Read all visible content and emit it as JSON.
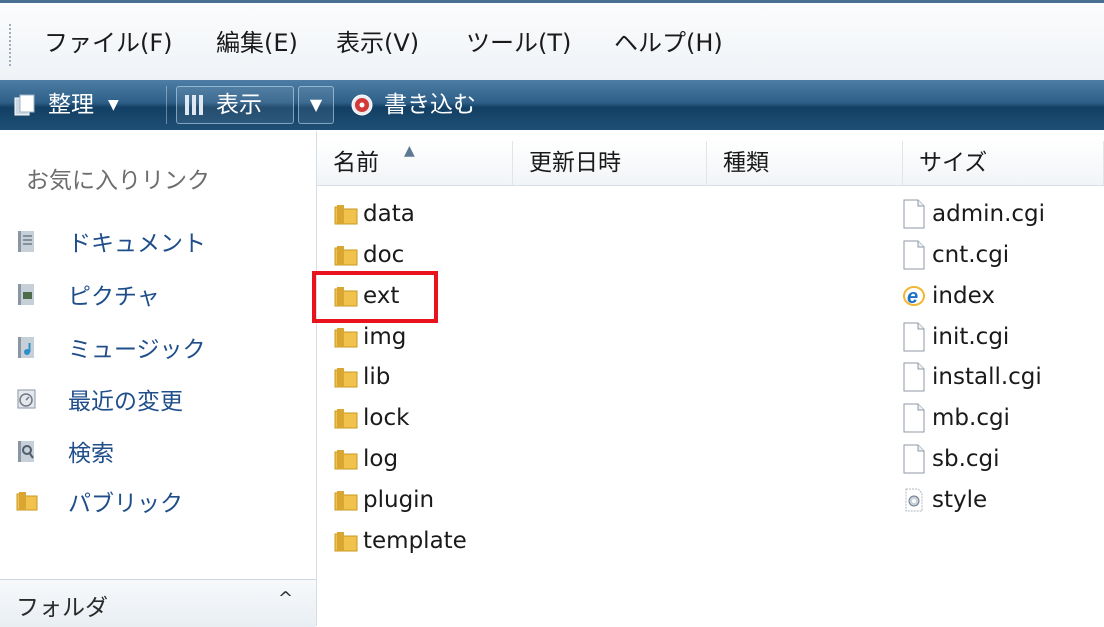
{
  "menu": {
    "file": "ファイル(F)",
    "edit": "編集(E)",
    "view": "表示(V)",
    "tools": "ツール(T)",
    "help": "ヘルプ(H)"
  },
  "toolbar": {
    "organize": "整理",
    "views": "表示",
    "burn": "書き込む"
  },
  "nav": {
    "favorites_title": "お気に入りリンク",
    "items": [
      {
        "label": "ドキュメント",
        "icon": "documents-icon"
      },
      {
        "label": "ピクチャ",
        "icon": "pictures-icon"
      },
      {
        "label": "ミュージック",
        "icon": "music-icon"
      },
      {
        "label": "最近の変更",
        "icon": "recent-icon"
      },
      {
        "label": "検索",
        "icon": "search-icon"
      },
      {
        "label": "パブリック",
        "icon": "public-folder-icon"
      }
    ],
    "folders_label": "フォルダ",
    "folders_chevron": "^"
  },
  "columns": {
    "name": "名前",
    "modified": "更新日時",
    "type": "種類",
    "size": "サイズ"
  },
  "folders": [
    "data",
    "doc",
    "ext",
    "img",
    "lib",
    "lock",
    "log",
    "plugin",
    "template"
  ],
  "files": [
    {
      "name": "admin.cgi",
      "icon": "file-icon"
    },
    {
      "name": "cnt.cgi",
      "icon": "file-icon"
    },
    {
      "name": "index",
      "icon": "ie-html-icon"
    },
    {
      "name": "init.cgi",
      "icon": "file-icon"
    },
    {
      "name": "install.cgi",
      "icon": "file-icon"
    },
    {
      "name": "mb.cgi",
      "icon": "file-icon"
    },
    {
      "name": "sb.cgi",
      "icon": "file-icon"
    },
    {
      "name": "style",
      "icon": "stylesheet-icon"
    }
  ],
  "colors": {
    "toolbar": "#1f4f76",
    "highlight": "#e8131c",
    "nav_link": "#1f4e8a",
    "folder": "#f1c24c"
  }
}
